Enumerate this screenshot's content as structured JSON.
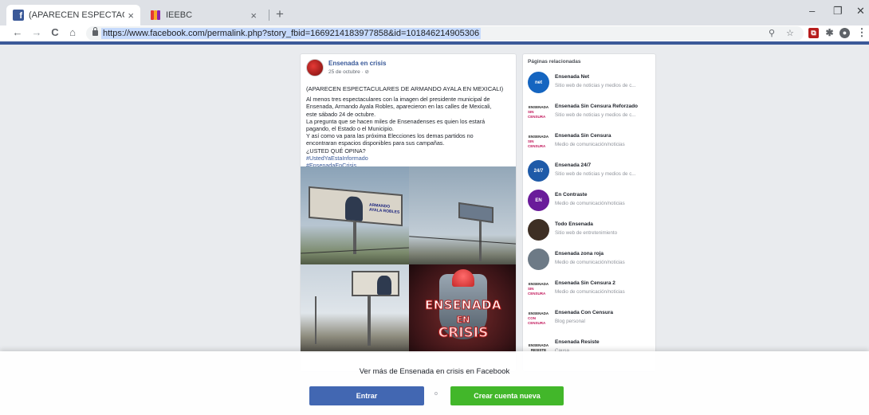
{
  "browser": {
    "tabs": [
      {
        "title": "(APARECEN ESPECTACULARES D",
        "close": "×"
      },
      {
        "title": "IEEBC",
        "close": "×"
      }
    ],
    "new_tab": "+",
    "window_controls": {
      "minimize": "–",
      "restore": "❐",
      "close": "✕"
    },
    "nav": {
      "back": "←",
      "forward": "→",
      "reload": "C",
      "home": "⌂"
    },
    "url": "https://www.facebook.com/permalink.php?story_fbid=1669214183977858&id=101846214905306",
    "menu": "⋮"
  },
  "post": {
    "page_name": "Ensenada en crisis",
    "date": "25 de octubre · ",
    "headline": "(APARECEN ESPECTACULARES DE ARMANDO AYALA EN MEXICALI)",
    "lines": [
      "Al menos tres espectaculares con la imagen del presidente municipal de",
      "Ensenada, Armando Ayala Robles, aparecieron en las calles de Mexicali,",
      "este sábado 24 de octubre.",
      "La pregunta que se hacen miles de Ensenadenses es quien los estará",
      "pagando, el Estado o el Municipio.",
      "Y así como va para las próxima Elecciones los demas partidos no",
      "encontraran espacios disponibles para sus campañas.",
      "¿USTED QUÉ OPINA?"
    ],
    "hashtags": [
      "#UstedYaEstaInformado",
      "#EnsenadaEnCrisis"
    ],
    "billboard_text": "ARMANDO AYALA ROBLES",
    "crisis_image": {
      "line1": "ENSENADA",
      "line2": "EN",
      "line3": "CRISIS"
    }
  },
  "related": {
    "title": "Páginas relacionadas",
    "items": [
      {
        "name": "Ensenada Net",
        "desc": "Sitio web de noticias y medios de c...",
        "icon_text": "net",
        "color": "#1565c0"
      },
      {
        "name": "Ensenada Sin Censura Reforzado",
        "desc": "Sitio web de noticias y medios de c...",
        "icon_text": "SIN CENSURA",
        "color": "#c2185b"
      },
      {
        "name": "Ensenada Sin Censura",
        "desc": "Medio de comunicación/noticias",
        "icon_text": "SIN CENSURA",
        "color": "#c2185b"
      },
      {
        "name": "Ensenada 24/7",
        "desc": "Sitio web de noticias y medios de c...",
        "icon_text": "24/7",
        "color": "#1e5aa8"
      },
      {
        "name": "En Contraste",
        "desc": "Medio de comunicación/noticias",
        "icon_text": "EN",
        "color": "#6a1b9a"
      },
      {
        "name": "Todo Ensenada",
        "desc": "Sitio web de entretenimiento",
        "icon_text": "",
        "color": "#3e2f24"
      },
      {
        "name": "Ensenada zona roja",
        "desc": "Medio de comunicación/noticias",
        "icon_text": "",
        "color": "#6d7a86"
      },
      {
        "name": "Ensenada Sin Censura 2",
        "desc": "Medio de comunicación/noticias",
        "icon_text": "SIN CENSURA",
        "color": "#c2185b"
      },
      {
        "name": "Ensenada Con Censura",
        "desc": "Blog personal",
        "icon_text": "CON CENSURA",
        "color": "#c2185b"
      },
      {
        "name": "Ensenada Resiste",
        "desc": "Causa",
        "icon_text": "RESISTE",
        "color": "#222222"
      }
    ]
  },
  "login_overlay": {
    "text": "Ver más de Ensenada en crisis en Facebook",
    "login_label": "Entrar",
    "or_label": "o",
    "signup_label": "Crear cuenta nueva"
  }
}
